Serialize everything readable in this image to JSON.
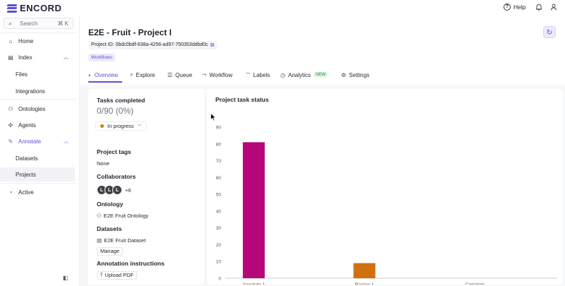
{
  "topbar": {
    "logo_text": "ENCORD",
    "help_label": "Help",
    "help_icon": "question-circle-icon",
    "bell_icon": "bell-icon",
    "user_icon": "user-icon"
  },
  "sidebar": {
    "search_label": "Search",
    "search_shortcut": "⌘ K",
    "items": {
      "home": "Home",
      "index": "Index",
      "files": "Files",
      "integrations": "Integrations",
      "ontologies": "Ontologies",
      "agents": "Agents",
      "annotate": "Annotate",
      "datasets": "Datasets",
      "projects": "Projects",
      "active": "Active"
    }
  },
  "project": {
    "title": "E2E - Fruit - Project I",
    "id_label": "Project ID: 0bdc0bdf-638a-4256-ad97-750353ddbd0c",
    "badge": "Workflows"
  },
  "tabs": {
    "overview": "Overview",
    "explore": "Explore",
    "queue": "Queue",
    "workflow": "Workflow",
    "labels": "Labels",
    "analytics": "Analytics",
    "analytics_badge": "NEW",
    "settings": "Settings"
  },
  "overview": {
    "tasks_completed_title": "Tasks completed",
    "tasks_completed_value": "0/90 (0%)",
    "status": "In progress",
    "tags_title": "Project tags",
    "tags_value": "None",
    "collaborators_title": "Collaborators",
    "collaborator_initial": "L",
    "collaborators_more": "+6",
    "ontology_title": "Ontology",
    "ontology_value": "E2E Fruit Ontology",
    "datasets_title": "Datasets",
    "datasets_value": "E2E Fruit Dataset",
    "manage_label": "Manage",
    "instructions_title": "Annotation instructions",
    "upload_label": "Upload PDF"
  },
  "colors": {
    "accent": "#5b4fd6",
    "bar_annotate": "#b5077a",
    "bar_review": "#d0700f",
    "status_dot": "#c97a15"
  },
  "chart_data": {
    "type": "bar",
    "title": "Project task status",
    "categories": [
      "Annotate 1",
      "Review 1",
      "Complete"
    ],
    "values": [
      81,
      9,
      0
    ],
    "colors": [
      "#b5077a",
      "#d0700f",
      "#cccccc"
    ],
    "ylim": [
      0,
      90
    ],
    "yticks": [
      0,
      10,
      20,
      30,
      40,
      50,
      60,
      70,
      80,
      90
    ],
    "grid": false
  }
}
